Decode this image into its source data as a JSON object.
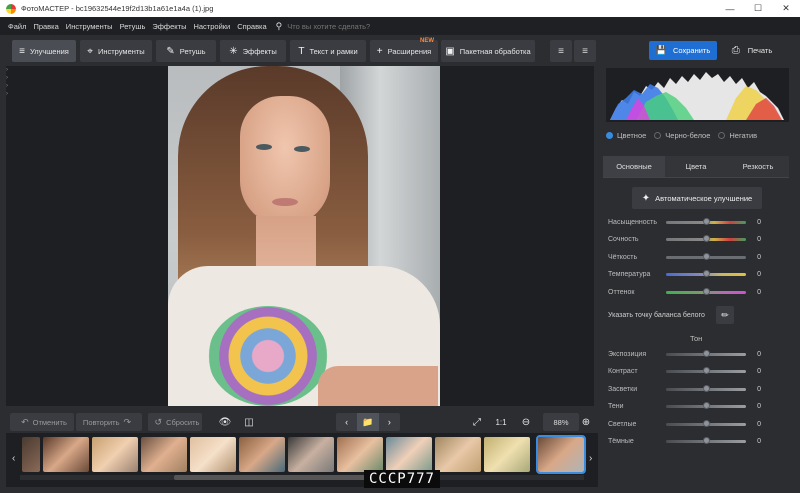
{
  "window": {
    "title": "ФотоМАСТЕР - bc19632544e19f2d13b1a61e1a4a (1).jpg"
  },
  "menu": {
    "items": [
      "Файл",
      "Правка",
      "Инструменты",
      "Ретушь",
      "Эффекты",
      "Настройки",
      "Справка"
    ],
    "search_placeholder": "Что вы хотите сделать?"
  },
  "toolbar": {
    "tabs": [
      {
        "label": "Улучшения",
        "icon": "sliders-icon"
      },
      {
        "label": "Инструменты",
        "icon": "crop-icon"
      },
      {
        "label": "Ретушь",
        "icon": "brush-icon"
      },
      {
        "label": "Эффекты",
        "icon": "sparkle-icon"
      },
      {
        "label": "Текст и рамки",
        "icon": "text-icon"
      },
      {
        "label": "Расширения",
        "icon": "plus-icon",
        "badge": "NEW"
      },
      {
        "label": "Пакетная обработка",
        "icon": "batch-icon"
      }
    ],
    "save_label": "Сохранить",
    "print_label": "Печать"
  },
  "bottom": {
    "undo_label": "Отменить",
    "redo_label": "Повторить",
    "reset_label": "Сбросить",
    "zoom_fit": "1:1",
    "zoom_value": "88%"
  },
  "watermark": "СССР777",
  "right": {
    "modes": [
      {
        "label": "Цветное",
        "selected": true
      },
      {
        "label": "Черно-белое",
        "selected": false
      },
      {
        "label": "Негатив",
        "selected": false
      }
    ],
    "tabs": [
      "Основные",
      "Цвета",
      "Резкость"
    ],
    "auto_label": "Автоматическое улучшение",
    "color_sliders": [
      {
        "label": "Насыщенность",
        "value": "0",
        "value_num": 0
      },
      {
        "label": "Сочность",
        "value": "0",
        "value_num": 0
      },
      {
        "label": "Чёткость",
        "value": "0",
        "value_num": 0
      },
      {
        "label": "Температура",
        "value": "0",
        "value_num": 0
      },
      {
        "label": "Оттенок",
        "value": "0",
        "value_num": 0
      }
    ],
    "white_balance_label": "Указать точку баланса белого",
    "tone_label": "Тон",
    "tone_sliders": [
      {
        "label": "Экспозиция",
        "value": "0",
        "value_num": 0
      },
      {
        "label": "Контраст",
        "value": "0",
        "value_num": 0
      },
      {
        "label": "Засветки",
        "value": "0",
        "value_num": 0
      },
      {
        "label": "Тени",
        "value": "0",
        "value_num": 0
      },
      {
        "label": "Светлые",
        "value": "0",
        "value_num": 0
      },
      {
        "label": "Тёмные",
        "value": "0",
        "value_num": 0
      }
    ]
  },
  "colors": {
    "accent": "#1f6ed4",
    "selected_thumb": "#3a8dde",
    "badge": "#ff8a3d"
  }
}
